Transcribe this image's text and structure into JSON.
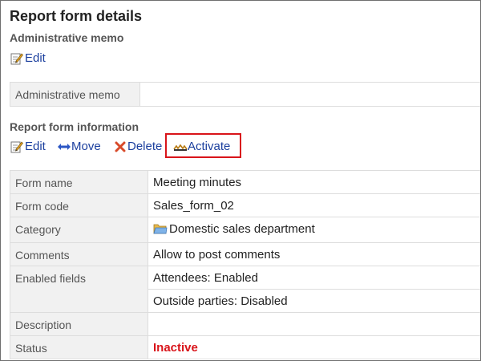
{
  "page": {
    "title": "Report form details"
  },
  "admin_memo": {
    "section_title": "Administrative memo",
    "edit_label": "Edit",
    "table_label": "Administrative memo",
    "table_value": ""
  },
  "report_form": {
    "section_title": "Report form information",
    "actions": {
      "edit": "Edit",
      "move": "Move",
      "delete": "Delete",
      "activate": "Activate"
    },
    "rows": {
      "form_name": {
        "label": "Form name",
        "value": "Meeting minutes"
      },
      "form_code": {
        "label": "Form code",
        "value": "Sales_form_02"
      },
      "category": {
        "label": "Category",
        "value": "Domestic sales department"
      },
      "comments": {
        "label": "Comments",
        "value": "Allow to post comments"
      },
      "enabled_fields": {
        "label": "Enabled fields",
        "values": [
          "Attendees: Enabled",
          "Outside parties: Disabled"
        ]
      },
      "description": {
        "label": "Description",
        "value": ""
      },
      "status": {
        "label": "Status",
        "value": "Inactive"
      }
    }
  },
  "colors": {
    "link": "#1b3f9e",
    "highlight": "#d9141a",
    "label_bg": "#f1f1f1",
    "status_inactive": "#d9141a"
  },
  "icons": {
    "edit": "edit-icon",
    "move": "move-arrows-icon",
    "delete": "delete-x-icon",
    "activate": "activate-icon",
    "category": "folder-icon"
  }
}
